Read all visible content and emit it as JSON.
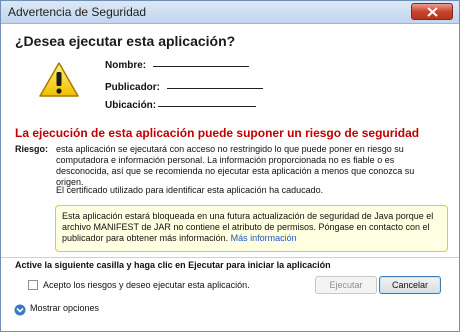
{
  "window": {
    "title": "Advertencia de Seguridad",
    "close_icon": "close-icon"
  },
  "header": {
    "question": "¿Desea ejecutar esta aplicación?",
    "icon": "warning-icon"
  },
  "fields": {
    "name_label": "Nombre:",
    "publisher_label": "Publicador:",
    "location_label": "Ubicación:"
  },
  "risk": {
    "heading": "La ejecución de esta aplicación puede suponer un riesgo de seguridad",
    "label": "Riesgo:",
    "text": "esta aplicación se ejecutará con acceso no restringido lo que puede poner en riesgo su computadora e información personal. La información proporcionada no es fiable o es desconocida, así que se recomienda no ejecutar esta aplicación a menos que conozca su origen.",
    "certificate_text": "El certificado utilizado para identificar esta aplicación ha caducado."
  },
  "notice": {
    "text": "Esta aplicación estará bloqueada en una futura actualización de seguridad de Java porque el archivo MANIFEST de JAR no contiene el atributo de permisos. Póngase en contacto con el publicador para obtener más información.",
    "link": "Más información"
  },
  "footer": {
    "instruction": "Active la siguiente casilla y haga clic en Ejecutar para iniciar la aplicación",
    "checkbox_label": "Acepto los riesgos y deseo ejecutar esta aplicación.",
    "checkbox_checked": false,
    "run_button": "Ejecutar",
    "cancel_button": "Cancelar",
    "more_options": "Mostrar opciones"
  },
  "colors": {
    "risk_heading": "#c00000",
    "notice_background": "#ffffe1",
    "link": "#1a56c4"
  }
}
